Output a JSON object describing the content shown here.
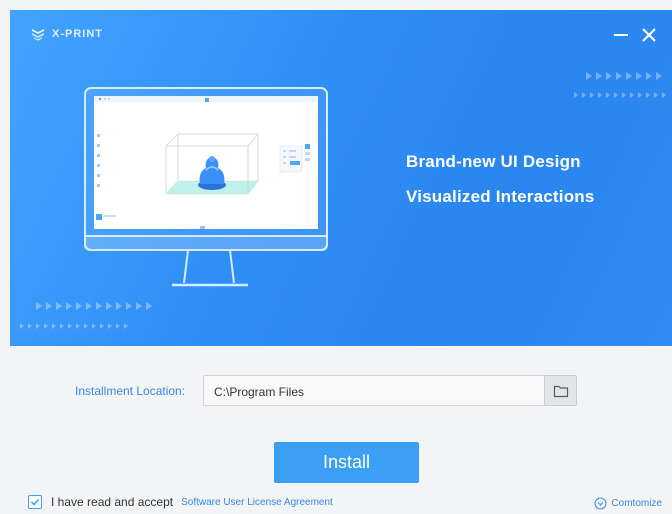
{
  "brand": {
    "name": "X-PRINT",
    "icon": "xprint-logo-icon"
  },
  "window_controls": {
    "minimize_icon": "minimize-icon",
    "close_icon": "close-icon"
  },
  "hero": {
    "headline_1": "Brand-new UI Design",
    "headline_2": "Visualized Interactions",
    "illustration": "monitor-3d-print-illustration"
  },
  "install_location": {
    "label": "Installment Location:",
    "value": "C:\\Program Files",
    "browse_icon": "folder-icon"
  },
  "install_button": {
    "label": "Install"
  },
  "agreement": {
    "checked": true,
    "text": "I have read and accept",
    "link": "Software User License Agreement"
  },
  "customize": {
    "label": "Comtomize",
    "icon": "chevron-down-circle-icon"
  },
  "colors": {
    "accent": "#3a9ff5",
    "link": "#3a87e0",
    "hero_start": "#42a3ff",
    "hero_end": "#2a86ef"
  }
}
